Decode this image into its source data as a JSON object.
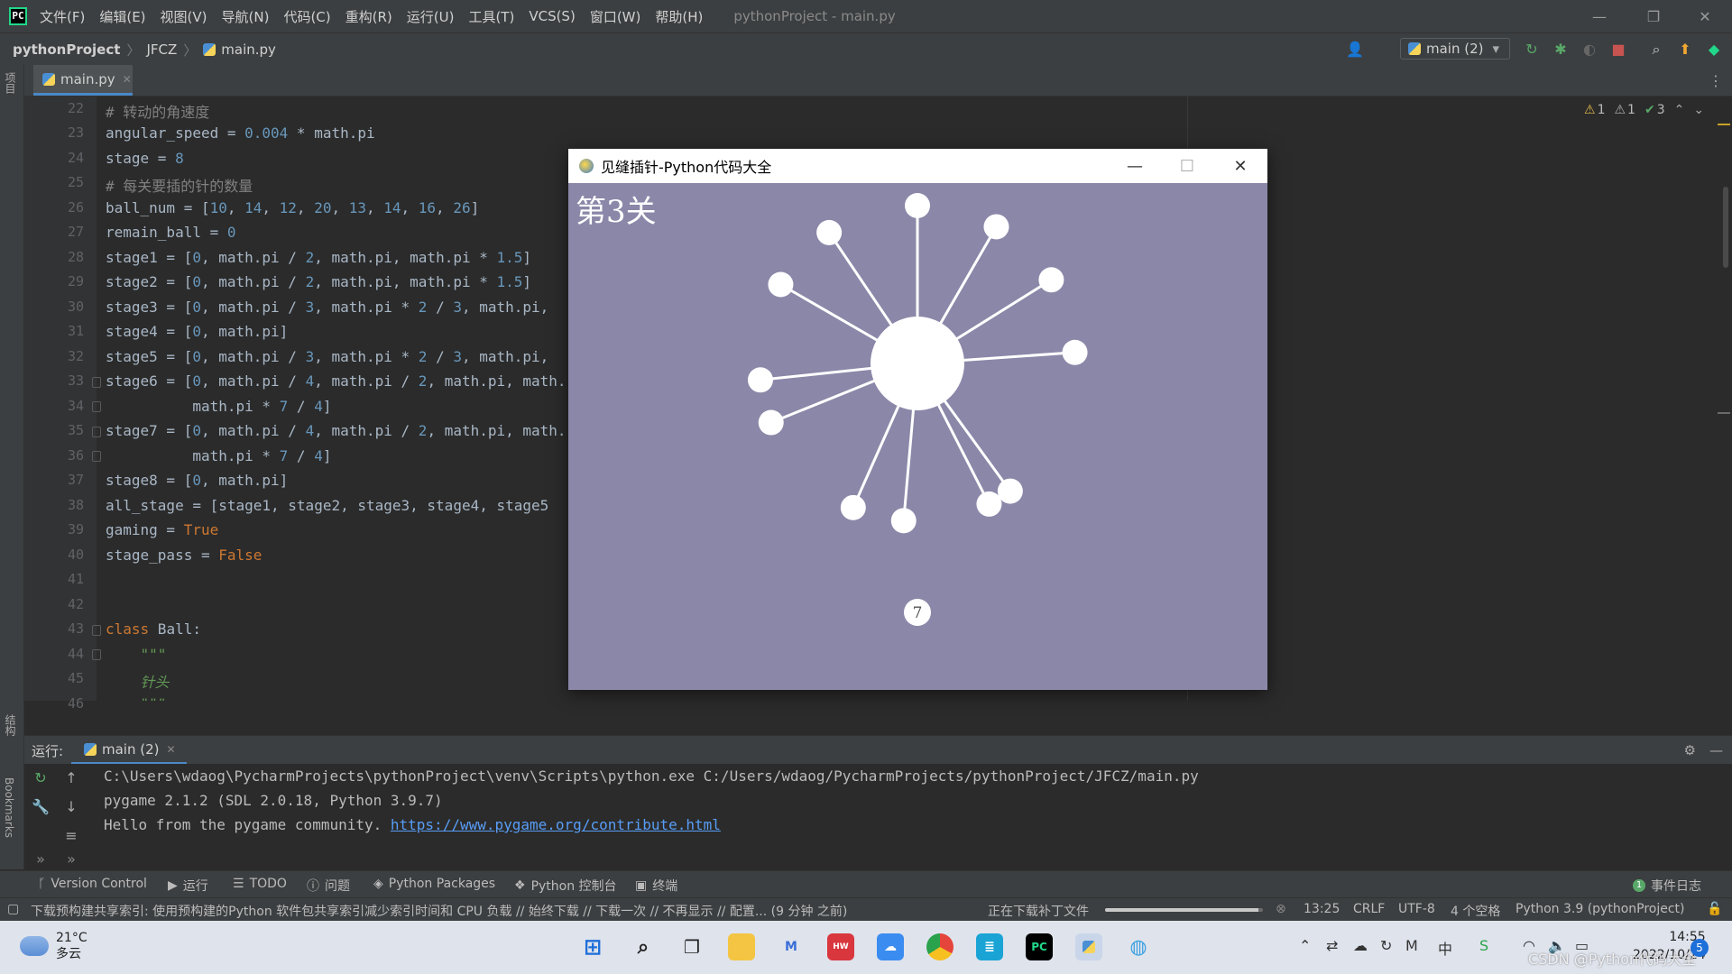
{
  "menubar": {
    "items": [
      "文件(F)",
      "编辑(E)",
      "视图(V)",
      "导航(N)",
      "代码(C)",
      "重构(R)",
      "运行(U)",
      "工具(T)",
      "VCS(S)",
      "窗口(W)",
      "帮助(H)"
    ],
    "window_title": "pythonProject - main.py"
  },
  "navbar": {
    "project": "pythonProject",
    "folder": "JFCZ",
    "file": "main.py",
    "run_config": "main (2)"
  },
  "leftstrip": {
    "project": "项目",
    "structure": "结构",
    "bookmarks": "Bookmarks"
  },
  "editor": {
    "tab": "main.py",
    "inspections": {
      "warnings1": "1",
      "warnings2": "1",
      "ok": "3"
    },
    "line_numbers": [
      "22",
      "23",
      "24",
      "25",
      "26",
      "27",
      "28",
      "29",
      "30",
      "31",
      "32",
      "33",
      "34",
      "35",
      "36",
      "37",
      "38",
      "39",
      "40",
      "41",
      "42",
      "43",
      "44",
      "45",
      "46"
    ]
  },
  "game": {
    "title": "见缝插针-Python代码大全",
    "level_text": "第3关",
    "remaining": "7",
    "colors": {
      "background": "#8b87a8",
      "pin": "#ffffff"
    },
    "pin_angles_deg": [
      -90,
      -60,
      -32,
      -124,
      -150,
      -4,
      174,
      158,
      114,
      95,
      63,
      54
    ]
  },
  "run": {
    "label": "运行:",
    "tab": "main (2)",
    "lines": [
      "C:\\Users\\wdaog\\PycharmProjects\\pythonProject\\venv\\Scripts\\python.exe C:/Users/wdaog/PycharmProjects/pythonProject/JFCZ/main.py",
      "pygame 2.1.2 (SDL 2.0.18, Python 3.9.7)",
      "Hello from the pygame community. "
    ],
    "link": "https://www.pygame.org/contribute.html"
  },
  "tooltabs": [
    "Version Control",
    "运行",
    "TODO",
    "问题",
    "Python Packages",
    "Python 控制台",
    "终端"
  ],
  "event_log": "事件日志",
  "statusbar": {
    "message": "下载预构建共享索引: 使用预构建的Python 软件包共享索引减少索引时间和 CPU 负载 // 始终下载 // 下载一次 // 不再显示 // 配置... (9 分钟 之前)",
    "downloading": "正在下载补丁文件",
    "progress": 0.97,
    "position": "13:25",
    "line_sep": "CRLF",
    "encoding": "UTF-8",
    "indent": "4 个空格",
    "interpreter": "Python 3.9 (pythonProject)"
  },
  "taskbar": {
    "temp": "21°C",
    "weather": "多云",
    "time": "14:55",
    "date": "2022/10/24",
    "notif": "5"
  },
  "watermark": "CSDN @Python代码大全"
}
